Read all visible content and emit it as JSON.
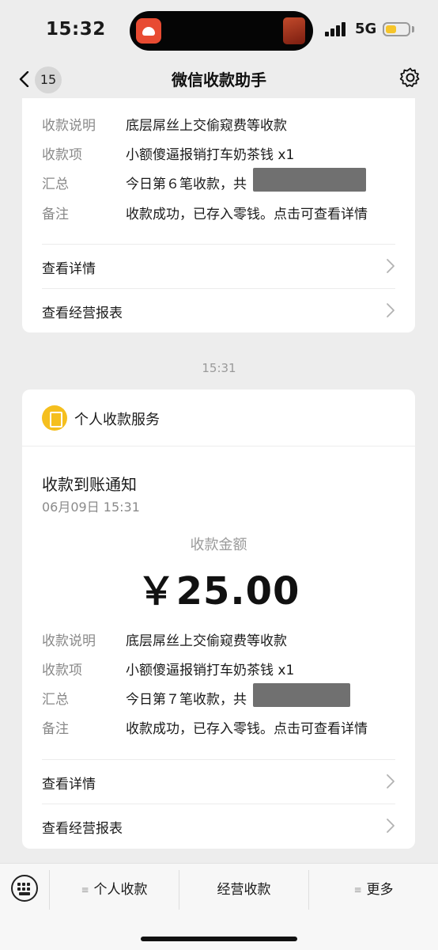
{
  "status_bar": {
    "time": "15:32",
    "network": "5G"
  },
  "nav": {
    "title": "微信收款助手",
    "unread_count": "15"
  },
  "previous_message": {
    "rows": [
      {
        "label": "收款说明",
        "value": "底层屌丝上交偷窥费等收款"
      },
      {
        "label": "收款项",
        "value": "小额傻逼报销打车奶茶钱 x1"
      },
      {
        "label": "汇总",
        "value": "今日第６笔收款，共"
      },
      {
        "label": "备注",
        "value": "收款成功，已存入零钱。点击可查看详情"
      }
    ],
    "links": [
      {
        "label": "查看详情"
      },
      {
        "label": "查看经营报表"
      }
    ]
  },
  "timestamp": "15:31",
  "latest_message": {
    "service_name": "个人收款服务",
    "notice_title": "收款到账通知",
    "notice_time": "06月09日 15:31",
    "amount_label": "收款金额",
    "amount": "￥25.00",
    "rows": [
      {
        "label": "收款说明",
        "value": "底层屌丝上交偷窥费等收款"
      },
      {
        "label": "收款项",
        "value": "小额傻逼报销打车奶茶钱 x1"
      },
      {
        "label": "汇总",
        "value": "今日第７笔收款，共"
      },
      {
        "label": "备注",
        "value": "收款成功，已存入零钱。点击可查看详情"
      }
    ],
    "links": [
      {
        "label": "查看详情"
      },
      {
        "label": "查看经营报表"
      }
    ]
  },
  "bottom_menu": {
    "items": [
      {
        "label": "个人收款",
        "has_submenu": true
      },
      {
        "label": "经营收款",
        "has_submenu": false
      },
      {
        "label": "更多",
        "has_submenu": true
      }
    ]
  },
  "colors": {
    "background": "#ededed",
    "card": "#ffffff",
    "service_logo": "#f5bf1e",
    "battery": "#f6c52a",
    "label_gray": "#888888"
  },
  "icons": [
    "back-chevron-icon",
    "gear-icon",
    "chevron-right-icon",
    "keyboard-icon",
    "menu-icon",
    "service-logo-icon"
  ]
}
